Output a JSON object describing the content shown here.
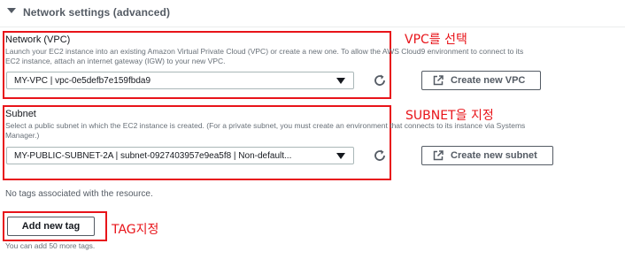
{
  "section": {
    "title": "Network settings (advanced)"
  },
  "vpc": {
    "label": "Network (VPC)",
    "description_line1": "Launch your EC2 instance into an existing Amazon Virtual Private Cloud (VPC) or create a new one. To allow the AWS Cloud9 environment to connect to its",
    "description_line2": "EC2 instance, attach an internet gateway (IGW) to your new VPC.",
    "selected": "MY-VPC | vpc-0e5defb7e159fbda9",
    "create_button": "Create new VPC",
    "annotation": "VPC를 선택"
  },
  "subnet": {
    "label": "Subnet",
    "description_line1": "Select a public subnet in which the EC2 instance is created. (For a private subnet, you must create an environment that connects to its instance via Systems",
    "description_line2": "Manager.)",
    "selected": "MY-PUBLIC-SUBNET-2A | subnet-0927403957e9ea5f8 | Non-default...",
    "create_button": "Create new subnet",
    "annotation": "SUBNET을 지정"
  },
  "tags": {
    "empty_text": "No tags associated with the resource.",
    "add_button": "Add new tag",
    "annotation": "TAG지정",
    "limit_text": "You can add 50 more tags."
  },
  "colors": {
    "annotation_red": "#e8141a",
    "border": "#545b64"
  }
}
